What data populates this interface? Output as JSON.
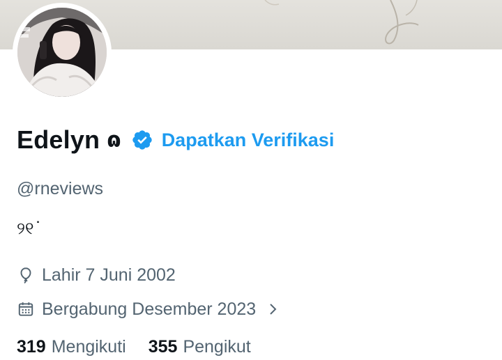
{
  "profile": {
    "display_name": "Edelyn",
    "name_glyph": "ɷ",
    "get_verified_label": "Dapatkan Verifikasi",
    "handle": "@rneviews",
    "bio": "୨୧˙",
    "birthdate": "Lahir 7 Juni 2002",
    "joined": "Bergabung Desember 2023",
    "following_count": "319",
    "following_label": "Mengikuti",
    "followers_count": "355",
    "followers_label": "Pengikut"
  },
  "colors": {
    "accent": "#1d9bf0",
    "text_primary": "#0f1419",
    "text_secondary": "#536471",
    "banner": "#dedcd7"
  },
  "icons": {
    "verified": "verified-badge-icon",
    "birthday": "balloon-icon",
    "joined": "calendar-icon",
    "chevron": "chevron-right-icon"
  }
}
